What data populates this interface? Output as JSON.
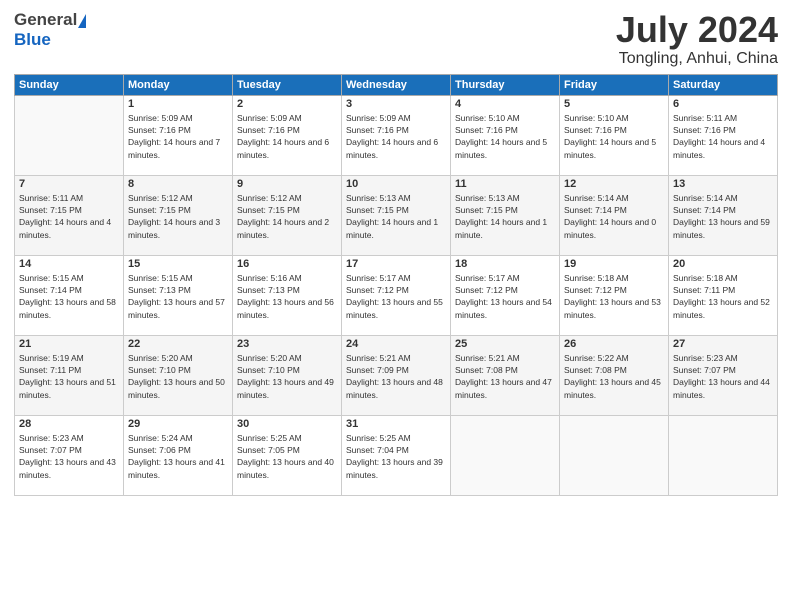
{
  "header": {
    "logo_general": "General",
    "logo_blue": "Blue",
    "month": "July 2024",
    "location": "Tongling, Anhui, China"
  },
  "days_of_week": [
    "Sunday",
    "Monday",
    "Tuesday",
    "Wednesday",
    "Thursday",
    "Friday",
    "Saturday"
  ],
  "weeks": [
    [
      {
        "day": "",
        "sunrise": "",
        "sunset": "",
        "daylight": ""
      },
      {
        "day": "1",
        "sunrise": "Sunrise: 5:09 AM",
        "sunset": "Sunset: 7:16 PM",
        "daylight": "Daylight: 14 hours and 7 minutes."
      },
      {
        "day": "2",
        "sunrise": "Sunrise: 5:09 AM",
        "sunset": "Sunset: 7:16 PM",
        "daylight": "Daylight: 14 hours and 6 minutes."
      },
      {
        "day": "3",
        "sunrise": "Sunrise: 5:09 AM",
        "sunset": "Sunset: 7:16 PM",
        "daylight": "Daylight: 14 hours and 6 minutes."
      },
      {
        "day": "4",
        "sunrise": "Sunrise: 5:10 AM",
        "sunset": "Sunset: 7:16 PM",
        "daylight": "Daylight: 14 hours and 5 minutes."
      },
      {
        "day": "5",
        "sunrise": "Sunrise: 5:10 AM",
        "sunset": "Sunset: 7:16 PM",
        "daylight": "Daylight: 14 hours and 5 minutes."
      },
      {
        "day": "6",
        "sunrise": "Sunrise: 5:11 AM",
        "sunset": "Sunset: 7:16 PM",
        "daylight": "Daylight: 14 hours and 4 minutes."
      }
    ],
    [
      {
        "day": "7",
        "sunrise": "Sunrise: 5:11 AM",
        "sunset": "Sunset: 7:15 PM",
        "daylight": "Daylight: 14 hours and 4 minutes."
      },
      {
        "day": "8",
        "sunrise": "Sunrise: 5:12 AM",
        "sunset": "Sunset: 7:15 PM",
        "daylight": "Daylight: 14 hours and 3 minutes."
      },
      {
        "day": "9",
        "sunrise": "Sunrise: 5:12 AM",
        "sunset": "Sunset: 7:15 PM",
        "daylight": "Daylight: 14 hours and 2 minutes."
      },
      {
        "day": "10",
        "sunrise": "Sunrise: 5:13 AM",
        "sunset": "Sunset: 7:15 PM",
        "daylight": "Daylight: 14 hours and 1 minute."
      },
      {
        "day": "11",
        "sunrise": "Sunrise: 5:13 AM",
        "sunset": "Sunset: 7:15 PM",
        "daylight": "Daylight: 14 hours and 1 minute."
      },
      {
        "day": "12",
        "sunrise": "Sunrise: 5:14 AM",
        "sunset": "Sunset: 7:14 PM",
        "daylight": "Daylight: 14 hours and 0 minutes."
      },
      {
        "day": "13",
        "sunrise": "Sunrise: 5:14 AM",
        "sunset": "Sunset: 7:14 PM",
        "daylight": "Daylight: 13 hours and 59 minutes."
      }
    ],
    [
      {
        "day": "14",
        "sunrise": "Sunrise: 5:15 AM",
        "sunset": "Sunset: 7:14 PM",
        "daylight": "Daylight: 13 hours and 58 minutes."
      },
      {
        "day": "15",
        "sunrise": "Sunrise: 5:15 AM",
        "sunset": "Sunset: 7:13 PM",
        "daylight": "Daylight: 13 hours and 57 minutes."
      },
      {
        "day": "16",
        "sunrise": "Sunrise: 5:16 AM",
        "sunset": "Sunset: 7:13 PM",
        "daylight": "Daylight: 13 hours and 56 minutes."
      },
      {
        "day": "17",
        "sunrise": "Sunrise: 5:17 AM",
        "sunset": "Sunset: 7:12 PM",
        "daylight": "Daylight: 13 hours and 55 minutes."
      },
      {
        "day": "18",
        "sunrise": "Sunrise: 5:17 AM",
        "sunset": "Sunset: 7:12 PM",
        "daylight": "Daylight: 13 hours and 54 minutes."
      },
      {
        "day": "19",
        "sunrise": "Sunrise: 5:18 AM",
        "sunset": "Sunset: 7:12 PM",
        "daylight": "Daylight: 13 hours and 53 minutes."
      },
      {
        "day": "20",
        "sunrise": "Sunrise: 5:18 AM",
        "sunset": "Sunset: 7:11 PM",
        "daylight": "Daylight: 13 hours and 52 minutes."
      }
    ],
    [
      {
        "day": "21",
        "sunrise": "Sunrise: 5:19 AM",
        "sunset": "Sunset: 7:11 PM",
        "daylight": "Daylight: 13 hours and 51 minutes."
      },
      {
        "day": "22",
        "sunrise": "Sunrise: 5:20 AM",
        "sunset": "Sunset: 7:10 PM",
        "daylight": "Daylight: 13 hours and 50 minutes."
      },
      {
        "day": "23",
        "sunrise": "Sunrise: 5:20 AM",
        "sunset": "Sunset: 7:10 PM",
        "daylight": "Daylight: 13 hours and 49 minutes."
      },
      {
        "day": "24",
        "sunrise": "Sunrise: 5:21 AM",
        "sunset": "Sunset: 7:09 PM",
        "daylight": "Daylight: 13 hours and 48 minutes."
      },
      {
        "day": "25",
        "sunrise": "Sunrise: 5:21 AM",
        "sunset": "Sunset: 7:08 PM",
        "daylight": "Daylight: 13 hours and 47 minutes."
      },
      {
        "day": "26",
        "sunrise": "Sunrise: 5:22 AM",
        "sunset": "Sunset: 7:08 PM",
        "daylight": "Daylight: 13 hours and 45 minutes."
      },
      {
        "day": "27",
        "sunrise": "Sunrise: 5:23 AM",
        "sunset": "Sunset: 7:07 PM",
        "daylight": "Daylight: 13 hours and 44 minutes."
      }
    ],
    [
      {
        "day": "28",
        "sunrise": "Sunrise: 5:23 AM",
        "sunset": "Sunset: 7:07 PM",
        "daylight": "Daylight: 13 hours and 43 minutes."
      },
      {
        "day": "29",
        "sunrise": "Sunrise: 5:24 AM",
        "sunset": "Sunset: 7:06 PM",
        "daylight": "Daylight: 13 hours and 41 minutes."
      },
      {
        "day": "30",
        "sunrise": "Sunrise: 5:25 AM",
        "sunset": "Sunset: 7:05 PM",
        "daylight": "Daylight: 13 hours and 40 minutes."
      },
      {
        "day": "31",
        "sunrise": "Sunrise: 5:25 AM",
        "sunset": "Sunset: 7:04 PM",
        "daylight": "Daylight: 13 hours and 39 minutes."
      },
      {
        "day": "",
        "sunrise": "",
        "sunset": "",
        "daylight": ""
      },
      {
        "day": "",
        "sunrise": "",
        "sunset": "",
        "daylight": ""
      },
      {
        "day": "",
        "sunrise": "",
        "sunset": "",
        "daylight": ""
      }
    ]
  ]
}
